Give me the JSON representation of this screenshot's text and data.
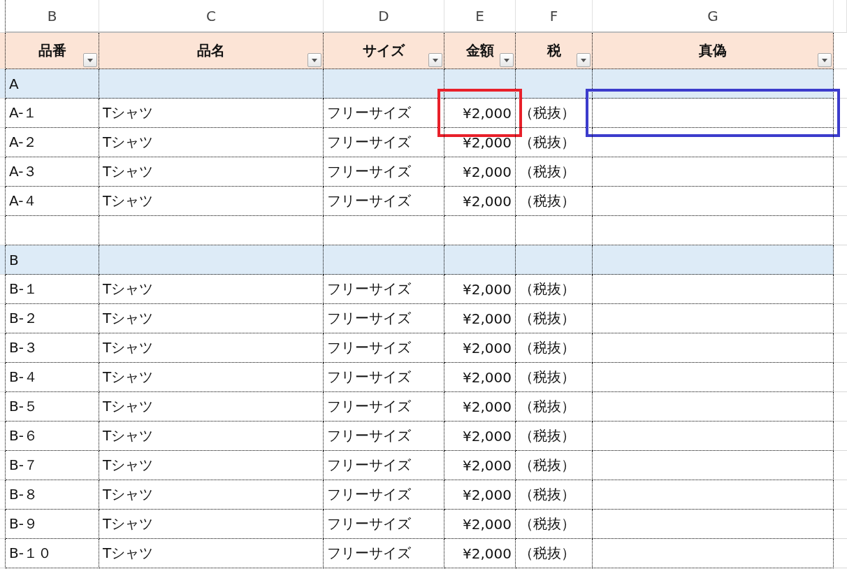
{
  "column_letters": [
    "B",
    "C",
    "D",
    "E",
    "F",
    "G"
  ],
  "headers": [
    "品番",
    "品名",
    "サイズ",
    "金額",
    "税",
    "真偽"
  ],
  "rows": [
    {
      "kind": "group",
      "label": "A"
    },
    {
      "kind": "item",
      "cells": [
        "A-１",
        "Tシャツ",
        "フリーサイズ",
        "¥2,000",
        "（税抜）"
      ],
      "frames": [
        {
          "kind": "price",
          "color": "#e8202a"
        },
        {
          "kind": "validity",
          "color": "#3c3ccc"
        }
      ]
    },
    {
      "kind": "item",
      "cells": [
        "A-２",
        "Tシャツ",
        "フリーサイズ",
        "¥2,000",
        "（税抜）"
      ]
    },
    {
      "kind": "item",
      "cells": [
        "A-３",
        "Tシャツ",
        "フリーサイズ",
        "¥2,000",
        "（税抜）"
      ]
    },
    {
      "kind": "item",
      "cells": [
        "A-４",
        "Tシャツ",
        "フリーサイズ",
        "¥2,000",
        "（税抜）"
      ]
    },
    {
      "kind": "blank"
    },
    {
      "kind": "group",
      "label": "B"
    },
    {
      "kind": "item",
      "cells": [
        "B-１",
        "Tシャツ",
        "フリーサイズ",
        "¥2,000",
        "（税抜）"
      ]
    },
    {
      "kind": "item",
      "cells": [
        "B-２",
        "Tシャツ",
        "フリーサイズ",
        "¥2,000",
        "（税抜）"
      ]
    },
    {
      "kind": "item",
      "cells": [
        "B-３",
        "Tシャツ",
        "フリーサイズ",
        "¥2,000",
        "（税抜）"
      ]
    },
    {
      "kind": "item",
      "cells": [
        "B-４",
        "Tシャツ",
        "フリーサイズ",
        "¥2,000",
        "（税抜）"
      ]
    },
    {
      "kind": "item",
      "cells": [
        "B-５",
        "Tシャツ",
        "フリーサイズ",
        "¥2,000",
        "（税抜）"
      ]
    },
    {
      "kind": "item",
      "cells": [
        "B-６",
        "Tシャツ",
        "フリーサイズ",
        "¥2,000",
        "（税抜）"
      ]
    },
    {
      "kind": "item",
      "cells": [
        "B-７",
        "Tシャツ",
        "フリーサイズ",
        "¥2,000",
        "（税抜）"
      ]
    },
    {
      "kind": "item",
      "cells": [
        "B-８",
        "Tシャツ",
        "フリーサイズ",
        "¥2,000",
        "（税抜）"
      ]
    },
    {
      "kind": "item",
      "cells": [
        "B-９",
        "Tシャツ",
        "フリーサイズ",
        "¥2,000",
        "（税抜）"
      ]
    },
    {
      "kind": "item",
      "cells": [
        "B-１０",
        "Tシャツ",
        "フリーサイズ",
        "¥2,000",
        "（税抜）"
      ]
    }
  ]
}
